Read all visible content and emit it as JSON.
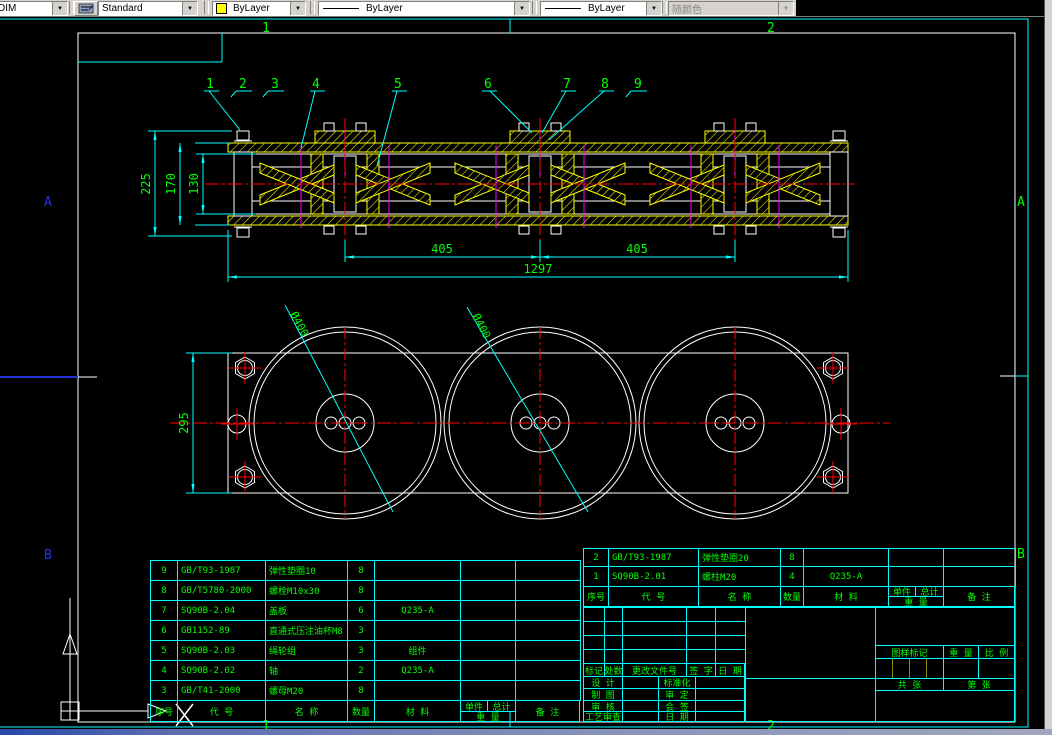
{
  "toolbar": {
    "dim_style_value": "DIM",
    "text_style_value": "Standard",
    "color_value": "ByLayer",
    "linetype_value": "ByLayer",
    "lineweight_value": "ByLayer",
    "plot_style_value": "随颜色",
    "dropdown_glyph": "▼"
  },
  "zones": {
    "left_top": "A",
    "left_bottom": "B",
    "right_top": "A",
    "right_bottom": "B",
    "top_1": "1",
    "top_2": "2",
    "bottom_1": "1",
    "bottom_2": "2"
  },
  "callouts": [
    "1",
    "2",
    "3",
    "4",
    "5",
    "6",
    "7",
    "8",
    "9"
  ],
  "dims": {
    "height_overall": "225",
    "height_plates": "170",
    "height_inner": "130",
    "span_1": "405",
    "span_2": "405",
    "length_overall": "1297",
    "plan_width": "295",
    "wheel_dia_1": "Ø400",
    "wheel_dia_2": "Ø400"
  },
  "ucs": {
    "x_label": "X"
  },
  "bom_headers": {
    "seq": "序号",
    "code": "代  号",
    "name": "名  称",
    "qty": "数量",
    "material": "材  料",
    "unit": "单件",
    "total": "总计",
    "weight": "重  量",
    "remark": "备  注"
  },
  "bom_left": {
    "rows": [
      {
        "seq": "9",
        "code": "GB/T93-1987",
        "name": "弹性垫圈10",
        "qty": "8",
        "material": "",
        "w": "",
        "remark": ""
      },
      {
        "seq": "8",
        "code": "GB/T5780-2000",
        "name": "螺栓M10x30",
        "qty": "8",
        "material": "",
        "w": "",
        "remark": ""
      },
      {
        "seq": "7",
        "code": "SQ90B-2.04",
        "name": "盖板",
        "qty": "6",
        "material": "Q235-A",
        "w": "",
        "remark": ""
      },
      {
        "seq": "6",
        "code": "GB1152-89",
        "name": "直通式压注油杯M8",
        "qty": "3",
        "material": "",
        "w": "",
        "remark": ""
      },
      {
        "seq": "5",
        "code": "SQ90B-2.03",
        "name": "绳轮组",
        "qty": "3",
        "material": "组件",
        "w": "",
        "remark": ""
      },
      {
        "seq": "4",
        "code": "SQ90B-2.02",
        "name": "轴",
        "qty": "2",
        "material": "Q235-A",
        "w": "",
        "remark": ""
      },
      {
        "seq": "3",
        "code": "GB/T41-2000",
        "name": "螺母M20",
        "qty": "8",
        "material": "",
        "w": "",
        "remark": ""
      }
    ]
  },
  "bom_right": {
    "rows": [
      {
        "seq": "2",
        "code": "GB/T93-1987",
        "name": "弹性垫圈20",
        "qty": "8",
        "material": "",
        "w": "",
        "remark": ""
      },
      {
        "seq": "1",
        "code": "SQ90B-2.01",
        "name": "螺柱M20",
        "qty": "4",
        "material": "Q235-A",
        "w": "",
        "remark": ""
      }
    ]
  },
  "titleblock": {
    "rev_headers": [
      "标记",
      "处数",
      "更改文件号",
      "签 字",
      "日 期"
    ],
    "sign_rows": [
      {
        "l": "设 计",
        "r": "标准化"
      },
      {
        "l": "制 图",
        "r": "审 定"
      },
      {
        "l": "审 核",
        "r": "会 签"
      },
      {
        "l": "工艺审查",
        "r": "日 期"
      }
    ],
    "stamp": {
      "mark": "图样标记",
      "weight": "重 量",
      "scale": "比 例",
      "total_sheets": "共  张",
      "sheet_no": "第  张"
    }
  }
}
